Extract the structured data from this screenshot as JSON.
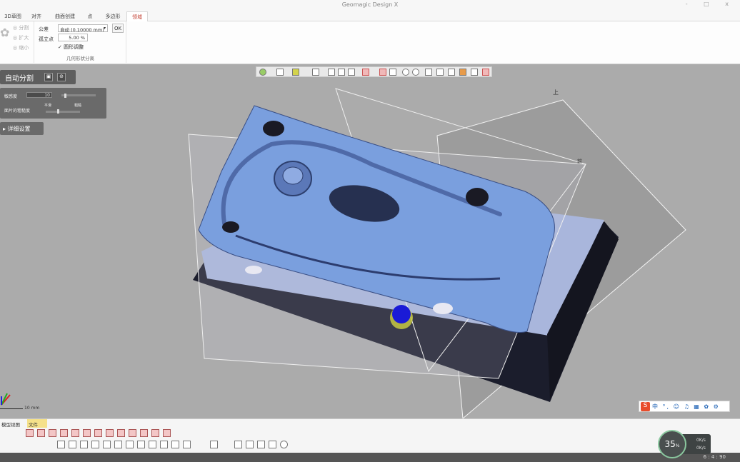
{
  "window": {
    "title": "Geomagic Design X",
    "controls": "- □ x"
  },
  "ribbon_tabs": [
    "3D草图",
    "对齐",
    "曲面创建",
    "点",
    "多边形",
    "领域"
  ],
  "ribbon": {
    "group1_buttons": [
      "分割",
      "扩大",
      "缩小"
    ],
    "tolerance_label": "公差",
    "tolerance_value": "自动 (0.10000 mm)",
    "ok_label": "OK",
    "isolate_label": "孤立点",
    "isolate_value": "5.00 %",
    "smooth_label": "圆形调整",
    "group_name": "几何形状分离"
  },
  "panel": {
    "title": "自动分割",
    "sensitivity_label": "敏感度",
    "sensitivity_value": "10",
    "roughness_label": "面片的粗糙度",
    "roughness_low": "平滑",
    "roughness_high": "粗糙",
    "detail_button": "▸ 详细设置"
  },
  "viewport": {
    "scale_label": "10 mm",
    "plane_label_top": "上",
    "plane_label_right": "前",
    "cursor_color": "#1a1ad6",
    "model_color": "#7a9fde"
  },
  "bottom": {
    "tabs": [
      "模型视图",
      "文件"
    ],
    "coords": "6 : 4 : 90"
  },
  "ime": {
    "logo": "S",
    "items": "中 °, ☺ ♫ ▦ ✿ ⚙"
  },
  "perf": {
    "percent": "35",
    "unit": "%",
    "up": "0K/s",
    "down": "0K/s"
  }
}
